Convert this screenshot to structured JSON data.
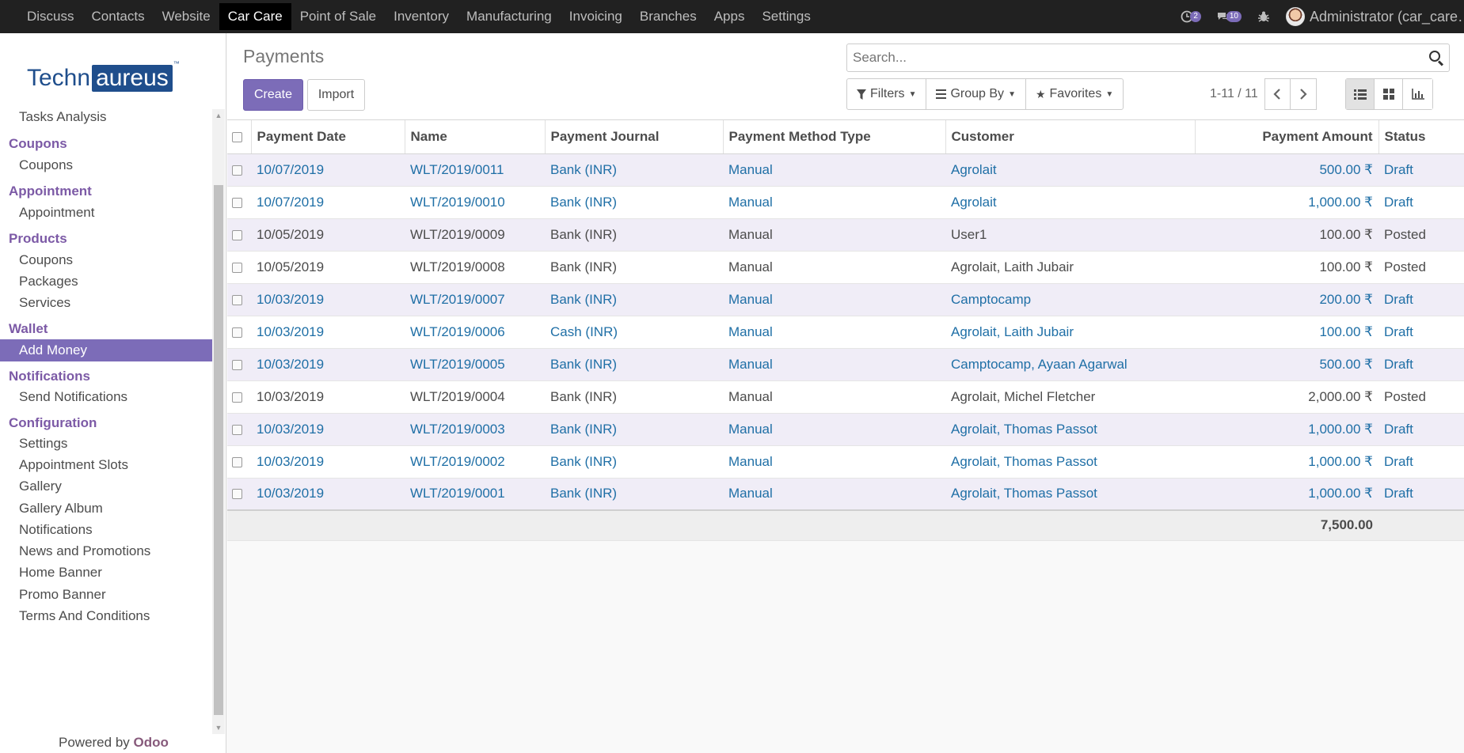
{
  "navbar": {
    "menu": [
      "Discuss",
      "Contacts",
      "Website",
      "Car Care",
      "Point of Sale",
      "Inventory",
      "Manufacturing",
      "Invoicing",
      "Branches",
      "Apps",
      "Settings"
    ],
    "active": "Car Care",
    "activity_count": "2",
    "message_count": "10",
    "user_name": "Administrator (car_care…"
  },
  "sidebar": {
    "logo_part1": "Techn",
    "logo_part2": "aureus",
    "logo_tm": "™",
    "items": [
      {
        "type": "item",
        "label": "Tasks Analysis"
      },
      {
        "type": "section",
        "label": "Coupons"
      },
      {
        "type": "item",
        "label": "Coupons"
      },
      {
        "type": "section",
        "label": "Appointment"
      },
      {
        "type": "item",
        "label": "Appointment"
      },
      {
        "type": "section",
        "label": "Products"
      },
      {
        "type": "item",
        "label": "Coupons"
      },
      {
        "type": "item",
        "label": "Packages"
      },
      {
        "type": "item",
        "label": "Services"
      },
      {
        "type": "section",
        "label": "Wallet"
      },
      {
        "type": "item",
        "label": "Add Money",
        "active": true
      },
      {
        "type": "section",
        "label": "Notifications"
      },
      {
        "type": "item",
        "label": "Send Notifications"
      },
      {
        "type": "section",
        "label": "Configuration"
      },
      {
        "type": "item",
        "label": "Settings"
      },
      {
        "type": "item",
        "label": "Appointment Slots"
      },
      {
        "type": "item",
        "label": "Gallery"
      },
      {
        "type": "item",
        "label": "Gallery Album"
      },
      {
        "type": "item",
        "label": "Notifications"
      },
      {
        "type": "item",
        "label": "News and Promotions"
      },
      {
        "type": "item",
        "label": "Home Banner"
      },
      {
        "type": "item",
        "label": "Promo Banner"
      },
      {
        "type": "item",
        "label": "Terms And Conditions"
      }
    ],
    "powered_prefix": "Powered by",
    "powered_brand": "Odoo"
  },
  "control_panel": {
    "title": "Payments",
    "create_label": "Create",
    "import_label": "Import",
    "search_placeholder": "Search...",
    "filters_label": "Filters",
    "group_by_label": "Group By",
    "favorites_label": "Favorites",
    "pager": "1-11 / 11"
  },
  "table": {
    "columns": [
      "Payment Date",
      "Name",
      "Payment Journal",
      "Payment Method Type",
      "Customer",
      "Payment Amount",
      "Status"
    ],
    "rows": [
      {
        "date": "10/07/2019",
        "name": "WLT/2019/0011",
        "journal": "Bank (INR)",
        "method": "Manual",
        "customer": "Agrolait",
        "amount": "500.00 ₹",
        "status": "Draft"
      },
      {
        "date": "10/07/2019",
        "name": "WLT/2019/0010",
        "journal": "Bank (INR)",
        "method": "Manual",
        "customer": "Agrolait",
        "amount": "1,000.00 ₹",
        "status": "Draft"
      },
      {
        "date": "10/05/2019",
        "name": "WLT/2019/0009",
        "journal": "Bank (INR)",
        "method": "Manual",
        "customer": "User1",
        "amount": "100.00 ₹",
        "status": "Posted"
      },
      {
        "date": "10/05/2019",
        "name": "WLT/2019/0008",
        "journal": "Bank (INR)",
        "method": "Manual",
        "customer": "Agrolait, Laith Jubair",
        "amount": "100.00 ₹",
        "status": "Posted"
      },
      {
        "date": "10/03/2019",
        "name": "WLT/2019/0007",
        "journal": "Bank (INR)",
        "method": "Manual",
        "customer": "Camptocamp",
        "amount": "200.00 ₹",
        "status": "Draft"
      },
      {
        "date": "10/03/2019",
        "name": "WLT/2019/0006",
        "journal": "Cash (INR)",
        "method": "Manual",
        "customer": "Agrolait, Laith Jubair",
        "amount": "100.00 ₹",
        "status": "Draft"
      },
      {
        "date": "10/03/2019",
        "name": "WLT/2019/0005",
        "journal": "Bank (INR)",
        "method": "Manual",
        "customer": "Camptocamp, Ayaan Agarwal",
        "amount": "500.00 ₹",
        "status": "Draft"
      },
      {
        "date": "10/03/2019",
        "name": "WLT/2019/0004",
        "journal": "Bank (INR)",
        "method": "Manual",
        "customer": "Agrolait, Michel Fletcher",
        "amount": "2,000.00 ₹",
        "status": "Posted"
      },
      {
        "date": "10/03/2019",
        "name": "WLT/2019/0003",
        "journal": "Bank (INR)",
        "method": "Manual",
        "customer": "Agrolait, Thomas Passot",
        "amount": "1,000.00 ₹",
        "status": "Draft"
      },
      {
        "date": "10/03/2019",
        "name": "WLT/2019/0002",
        "journal": "Bank (INR)",
        "method": "Manual",
        "customer": "Agrolait, Thomas Passot",
        "amount": "1,000.00 ₹",
        "status": "Draft"
      },
      {
        "date": "10/03/2019",
        "name": "WLT/2019/0001",
        "journal": "Bank (INR)",
        "method": "Manual",
        "customer": "Agrolait, Thomas Passot",
        "amount": "1,000.00 ₹",
        "status": "Draft"
      }
    ],
    "total": "7,500.00"
  },
  "colors": {
    "accent": "#7c6cb8",
    "link": "#1f6fa6",
    "section": "#7c5aa6",
    "navbar": "#212121"
  }
}
